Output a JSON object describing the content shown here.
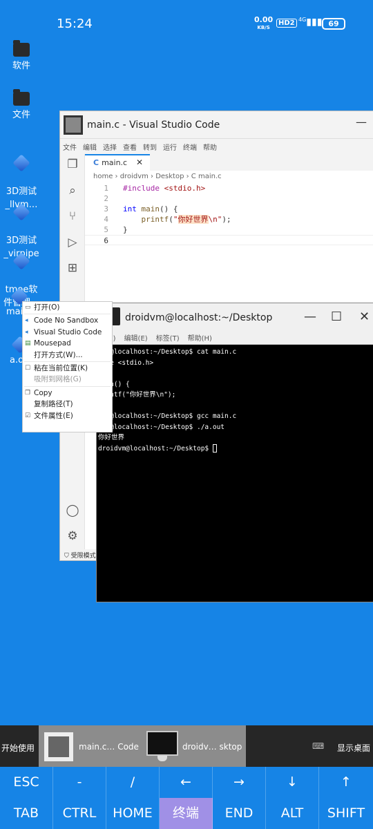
{
  "status_bar": {
    "time": "15:24",
    "net_speed": "0.00",
    "net_unit": "KB/S",
    "hd": "HD2",
    "signal": "4G",
    "battery": "69"
  },
  "desktop_icons": [
    {
      "label": "软件",
      "icon": "folder-icon"
    },
    {
      "label": "文件",
      "icon": "folder-icon"
    },
    {
      "label": "3D测试\n_llvm…",
      "icon": "app-icon"
    },
    {
      "label": "3D测试\n_virpipe",
      "icon": "app-icon"
    },
    {
      "label": "tmoe软\n件管理…",
      "icon": "app-icon"
    },
    {
      "label": "mai",
      "icon": "file-icon"
    },
    {
      "label": "a.o",
      "icon": "file-icon"
    }
  ],
  "vscode": {
    "title": "main.c - Visual Studio Code",
    "minimize": "—",
    "menu": [
      "文件",
      "编辑",
      "选择",
      "查看",
      "转到",
      "运行",
      "终端",
      "帮助"
    ],
    "tab": {
      "icon": "C",
      "label": "main.c",
      "close": "✕"
    },
    "breadcrumb": "home › droidvm › Desktop › C main.c",
    "status": "受限模式",
    "code": [
      {
        "n": "1",
        "text": "#include <stdio.h>"
      },
      {
        "n": "2",
        "text": ""
      },
      {
        "n": "3",
        "text": "int main() {"
      },
      {
        "n": "4",
        "text": "    printf(\"你好世界\\n\");"
      },
      {
        "n": "5",
        "text": "}"
      },
      {
        "n": "6",
        "text": ""
      }
    ]
  },
  "terminal": {
    "title": "droidvm@localhost:~/Desktop",
    "buttons": [
      "—",
      "☐",
      "✕"
    ],
    "menu": [
      "件(F)",
      "编辑(E)",
      "标签(T)",
      "帮助(H)"
    ],
    "lines": [
      "dvm@localhost:~/Desktop$ cat main.c",
      "lude <stdio.h>",
      "",
      "main() {",
      "printf(\"你好世界\\n\");",
      "",
      "dvm@localhost:~/Desktop$ gcc main.c",
      "dvm@localhost:~/Desktop$ ./a.out",
      "你好世界",
      "droidvm@localhost:~/Desktop$ "
    ]
  },
  "context_menu": {
    "items": [
      {
        "label": "打开(O)",
        "icon": "open-icon",
        "enabled": true
      },
      {
        "label": "Code No Sandbox",
        "icon": "vscode-icon",
        "enabled": true
      },
      {
        "label": "Visual Studio Code",
        "icon": "vscode-icon",
        "enabled": true
      },
      {
        "label": "Mousepad",
        "icon": "mousepad-icon",
        "enabled": true
      },
      {
        "label": "打开方式(W)...",
        "icon": "",
        "enabled": true
      },
      {
        "label": "粘在当前位置(K)",
        "icon": "checkbox-icon",
        "enabled": true
      },
      {
        "label": "吸附到网格(G)",
        "icon": "",
        "enabled": false
      },
      {
        "label": "Copy",
        "icon": "copy-icon",
        "enabled": true
      },
      {
        "label": "复制路径(T)",
        "icon": "",
        "enabled": true
      },
      {
        "label": "文件属性(E)",
        "icon": "properties-icon",
        "enabled": true
      }
    ]
  },
  "taskbar": {
    "start": "开始使用",
    "task1": "main.c… Code",
    "task2": "droidv… sktop",
    "show_desktop": "显示桌面"
  },
  "keys": {
    "row1": [
      "ESC",
      "-",
      "/",
      "←",
      "→",
      "↓",
      "↑"
    ],
    "row2": [
      "TAB",
      "CTRL",
      "HOME",
      "终端",
      "END",
      "ALT",
      "SHIFT"
    ]
  },
  "colors": {
    "desktop": "#1684e6",
    "terminal_bg": "#000000",
    "key_active": "#a090e6"
  }
}
